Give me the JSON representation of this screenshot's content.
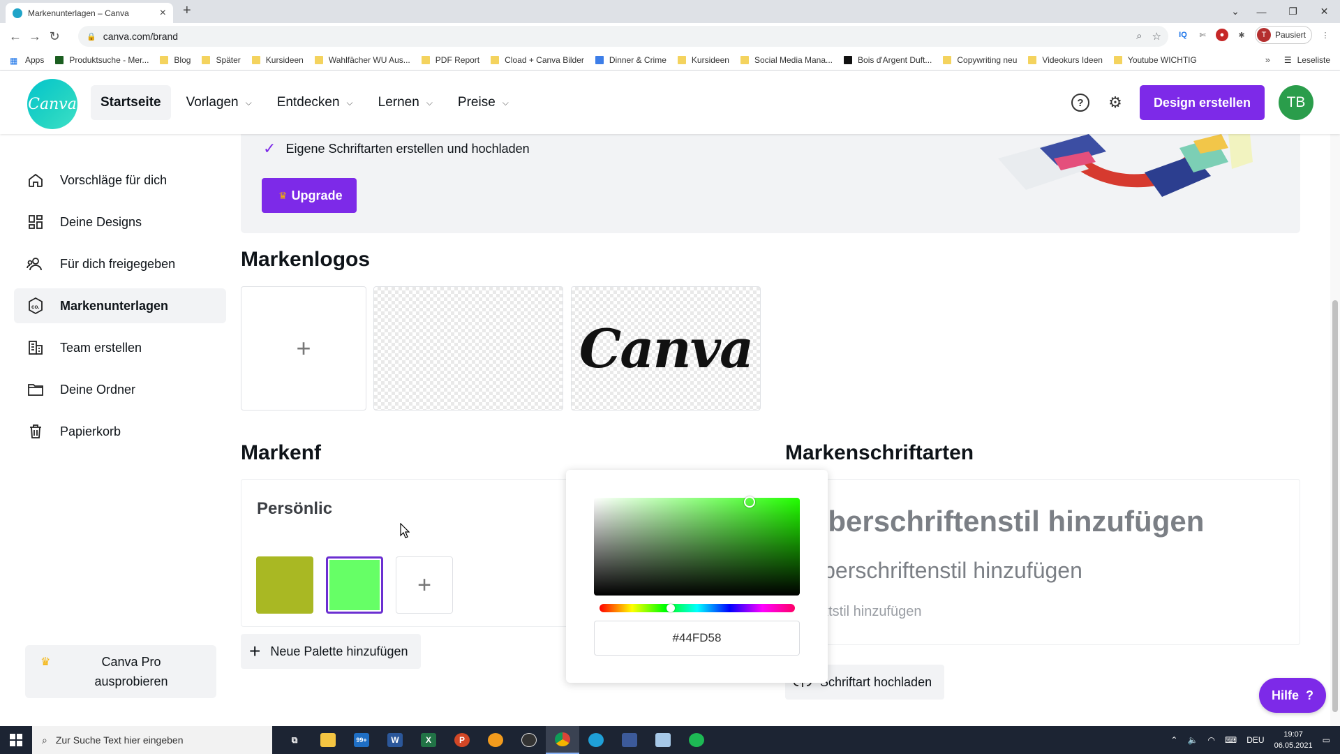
{
  "browser": {
    "tab_title": "Markenunterlagen – Canva",
    "url": "canva.com/brand",
    "profile_initial": "T",
    "profile_status": "Pausiert",
    "bookmarks": [
      {
        "label": "Apps",
        "icon": "apps-grid-icon"
      },
      {
        "label": "Produktsuche - Mer...",
        "icon": "green-favicon"
      },
      {
        "label": "Blog",
        "icon": "folder-icon"
      },
      {
        "label": "Später",
        "icon": "folder-icon"
      },
      {
        "label": "Kursideen",
        "icon": "folder-icon"
      },
      {
        "label": "Wahlfächer WU Aus...",
        "icon": "folder-icon"
      },
      {
        "label": "PDF Report",
        "icon": "folder-icon"
      },
      {
        "label": "Cload + Canva Bilder",
        "icon": "folder-icon"
      },
      {
        "label": "Dinner & Crime",
        "icon": "jd-favicon"
      },
      {
        "label": "Kursideen",
        "icon": "folder-icon"
      },
      {
        "label": "Social Media Mana...",
        "icon": "folder-icon"
      },
      {
        "label": "Bois d'Argent Duft...",
        "icon": "black-favicon"
      },
      {
        "label": "Copywriting neu",
        "icon": "folder-icon"
      },
      {
        "label": "Videokurs Ideen",
        "icon": "folder-icon"
      },
      {
        "label": "Youtube WICHTIG",
        "icon": "folder-icon"
      }
    ],
    "more_bookmarks": "»",
    "reading_list": "Leseliste"
  },
  "header": {
    "logo_text": "Canva",
    "nav": [
      {
        "label": "Startseite",
        "active": true,
        "dropdown": false
      },
      {
        "label": "Vorlagen",
        "active": false,
        "dropdown": true
      },
      {
        "label": "Entdecken",
        "active": false,
        "dropdown": true
      },
      {
        "label": "Lernen",
        "active": false,
        "dropdown": true
      },
      {
        "label": "Preise",
        "active": false,
        "dropdown": true
      }
    ],
    "create_button": "Design erstellen",
    "avatar_initials": "TB"
  },
  "sidebar": {
    "items": [
      {
        "label": "Vorschläge für dich",
        "icon": "home-icon"
      },
      {
        "label": "Deine Designs",
        "icon": "grid-icon"
      },
      {
        "label": "Für dich freigegeben",
        "icon": "users-icon"
      },
      {
        "label": "Markenunterlagen",
        "icon": "brand-icon",
        "active": true
      },
      {
        "label": "Team erstellen",
        "icon": "team-icon"
      },
      {
        "label": "Deine Ordner",
        "icon": "folder-icon"
      },
      {
        "label": "Papierkorb",
        "icon": "trash-icon"
      }
    ],
    "pro_cta_line1": "Canva Pro",
    "pro_cta_line2": "ausprobieren"
  },
  "banner": {
    "feature": "Eigene Schriftarten erstellen und hochladen",
    "upgrade_button": "Upgrade"
  },
  "logos": {
    "title": "Markenlogos",
    "logo_text": "Canva"
  },
  "colors": {
    "title": "Markenf",
    "palette_name": "Persönlic",
    "swatches": [
      "#a9b823",
      "#66ff66"
    ],
    "add_palette": "Neue Palette hinzufügen"
  },
  "picker": {
    "hex_value": "#44FD58",
    "hue_color": "#22ff00"
  },
  "fonts": {
    "title": "Markenschriftarten",
    "heading": "Überschriftenstil hinzufügen",
    "subheading": "Überschriftenstil hinzufügen",
    "body": "Textstil hinzufügen",
    "upload_button": "Schriftart hochladen"
  },
  "help_button": "Hilfe",
  "taskbar": {
    "search_placeholder": "Zur Suche Text hier eingeben",
    "mail_badge": "99+",
    "language": "DEU",
    "time": "19:07",
    "date": "06.05.2021"
  },
  "colors_theme": {
    "accent": "#7d2ae8",
    "canva_teal": "#02c4cc"
  }
}
